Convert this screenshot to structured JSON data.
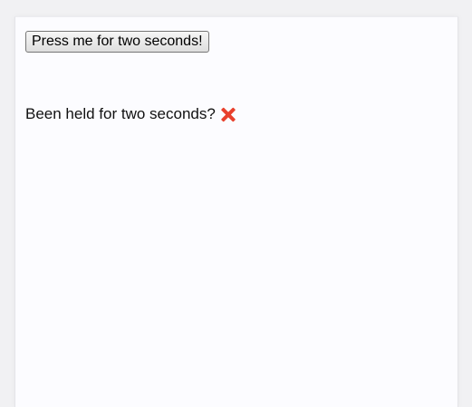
{
  "button": {
    "label": "Press me for two seconds!"
  },
  "status": {
    "text": "Been held for two seconds?",
    "icon": "cross-mark-icon",
    "icon_color": "#e8402c"
  }
}
